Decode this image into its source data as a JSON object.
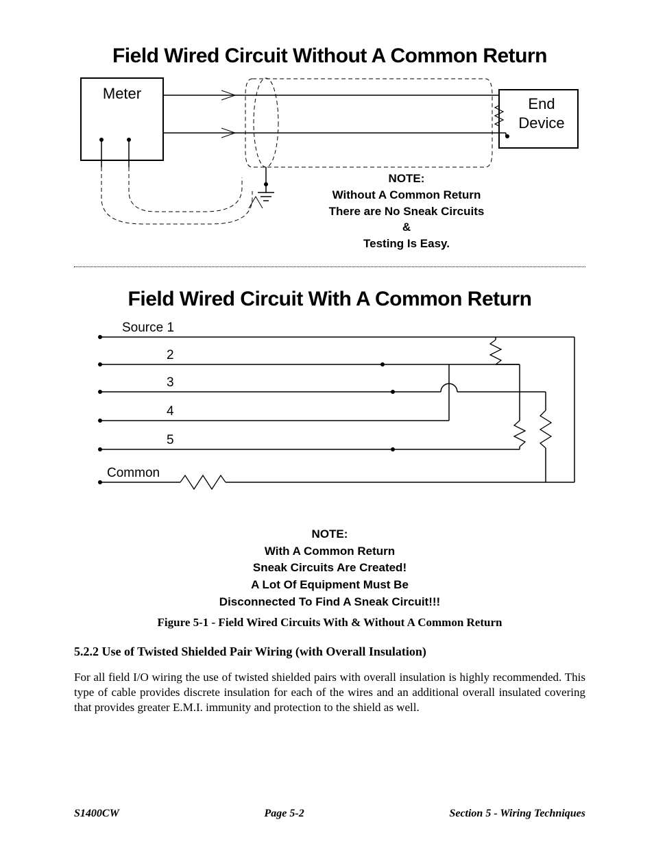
{
  "figure1": {
    "title": "Field Wired Circuit Without A Common Return",
    "meter_label": "Meter",
    "end_device_label1": "End",
    "end_device_label2": "Device",
    "note_heading": "NOTE:",
    "note_line1": "Without A Common Return",
    "note_line2": "There are No Sneak Circuits",
    "note_line3": "&",
    "note_line4": "Testing Is Easy."
  },
  "figure2": {
    "title": "Field Wired Circuit With A Common Return",
    "source_labels": [
      "Source 1",
      "2",
      "3",
      "4",
      "5",
      "Common"
    ],
    "note_heading": "NOTE:",
    "note_line1": "With A Common Return",
    "note_line2": "Sneak Circuits Are Created!",
    "note_line3": "A Lot Of Equipment Must Be",
    "note_line4": "Disconnected To Find A Sneak Circuit!!!"
  },
  "caption": "Figure 5-1 - Field Wired Circuits With & Without A Common Return",
  "section": {
    "heading": "5.2.2 Use of Twisted Shielded Pair Wiring  (with Overall Insulation)",
    "body": "For all field I/O wiring the use of twisted shielded pairs with overall insulation is highly recommended. This type of cable provides discrete insulation for each of the wires and an additional overall insulated covering that provides greater E.M.I. immunity and protection to the shield as well."
  },
  "footer": {
    "left": "S1400CW",
    "center": "Page 5-2",
    "right": "Section 5 - Wiring Techniques"
  }
}
